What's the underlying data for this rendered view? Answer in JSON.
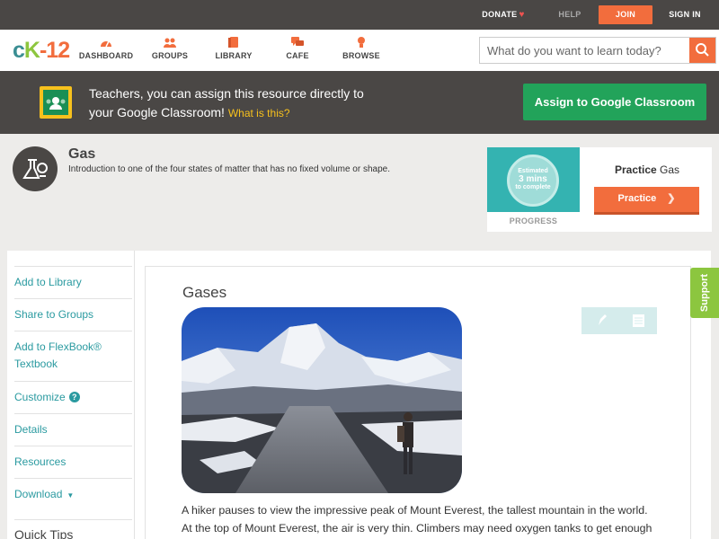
{
  "topbar": {
    "donate": "DONATE",
    "help": "HELP",
    "join": "JOIN",
    "signin": "SIGN IN"
  },
  "logo": {
    "c": "c",
    "k": "K",
    "n": "-12"
  },
  "nav": {
    "items": [
      {
        "label": "DASHBOARD",
        "icon": "dashboard-icon"
      },
      {
        "label": "GROUPS",
        "icon": "groups-icon"
      },
      {
        "label": "LIBRARY",
        "icon": "library-icon"
      },
      {
        "label": "CAFE",
        "icon": "cafe-icon"
      },
      {
        "label": "BROWSE",
        "icon": "browse-icon"
      }
    ],
    "search_placeholder": "What do you want to learn today?"
  },
  "banner": {
    "line1": "Teachers, you can assign this resource directly to",
    "line2": "your Google Classroom!",
    "what": "What is this?",
    "assign_label": "Assign to Google Classroom"
  },
  "concept": {
    "title": "Gas",
    "description": "Introduction to one of the four states of matter that has no fixed volume or shape."
  },
  "practice": {
    "estimated": "Estimated",
    "mins": "3 mins",
    "to_complete": "to complete",
    "progress_label": "PROGRESS",
    "heading_bold": "Practice",
    "heading_rest": "Gas",
    "button_label": "Practice"
  },
  "sidebar": {
    "items": [
      "Add to Library",
      "Share to Groups",
      "Add to FlexBook®",
      "Textbook",
      "Customize",
      "Details",
      "Resources",
      "Download"
    ],
    "quick_tips": "Quick Tips"
  },
  "main": {
    "title": "Gases",
    "line1": "A hiker pauses to view the impressive peak of Mount Everest, the tallest mountain in the world.",
    "line2": "At the top of Mount Everest, the air is very thin. Climbers may need oxygen tanks to get enough"
  },
  "support": "Support",
  "colors": {
    "accent_orange": "#f26d3d",
    "teal": "#2a9aa0",
    "green": "#22a35a",
    "dark_bar": "#4a4745",
    "support_green": "#8cc63f"
  }
}
